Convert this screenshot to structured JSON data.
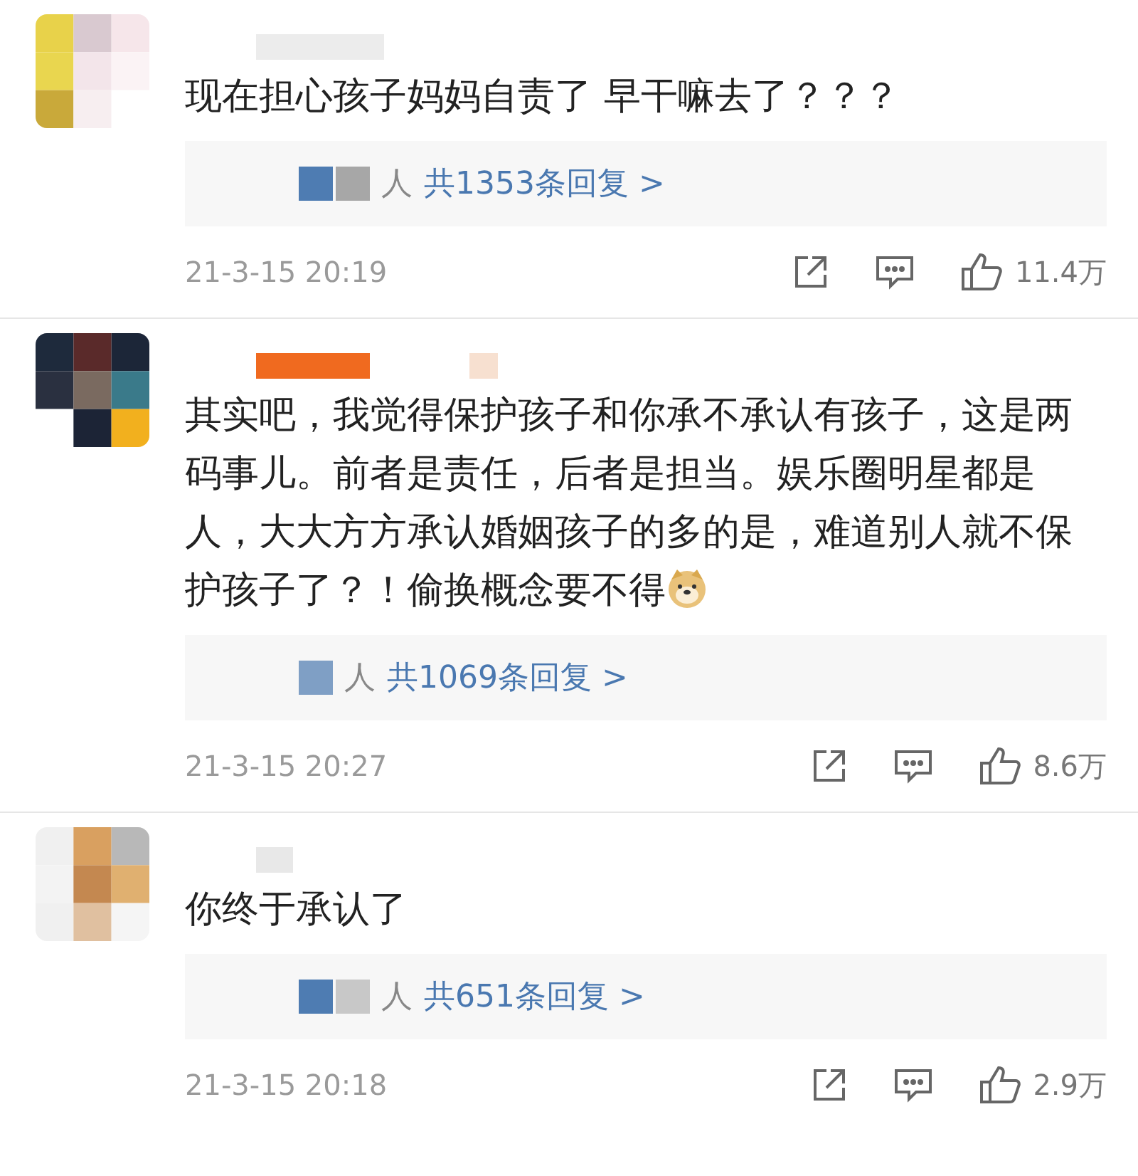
{
  "comments": [
    {
      "text": "现在担心孩子妈妈自责了  早干嘛去了？？？",
      "reply_prefix": "人",
      "reply_link": "共1353条回复 >",
      "time": "21-3-15 20:19",
      "likes": "11.4万",
      "emoji": false
    },
    {
      "text": "其实吧，我觉得保护孩子和你承不承认有孩子，这是两码事儿。前者是责任，后者是担当。娱乐圈明星都是人，大大方方承认婚姻孩子的多的是，难道别人就不保护孩子了？！偷换概念要不得",
      "reply_prefix": "人",
      "reply_link": "共1069条回复 >",
      "time": "21-3-15 20:27",
      "likes": "8.6万",
      "emoji": true
    },
    {
      "text": "你终于承认了",
      "reply_prefix": "人",
      "reply_link": "共651条回复 >",
      "time": "21-3-15 20:18",
      "likes": "2.9万",
      "emoji": false
    }
  ]
}
